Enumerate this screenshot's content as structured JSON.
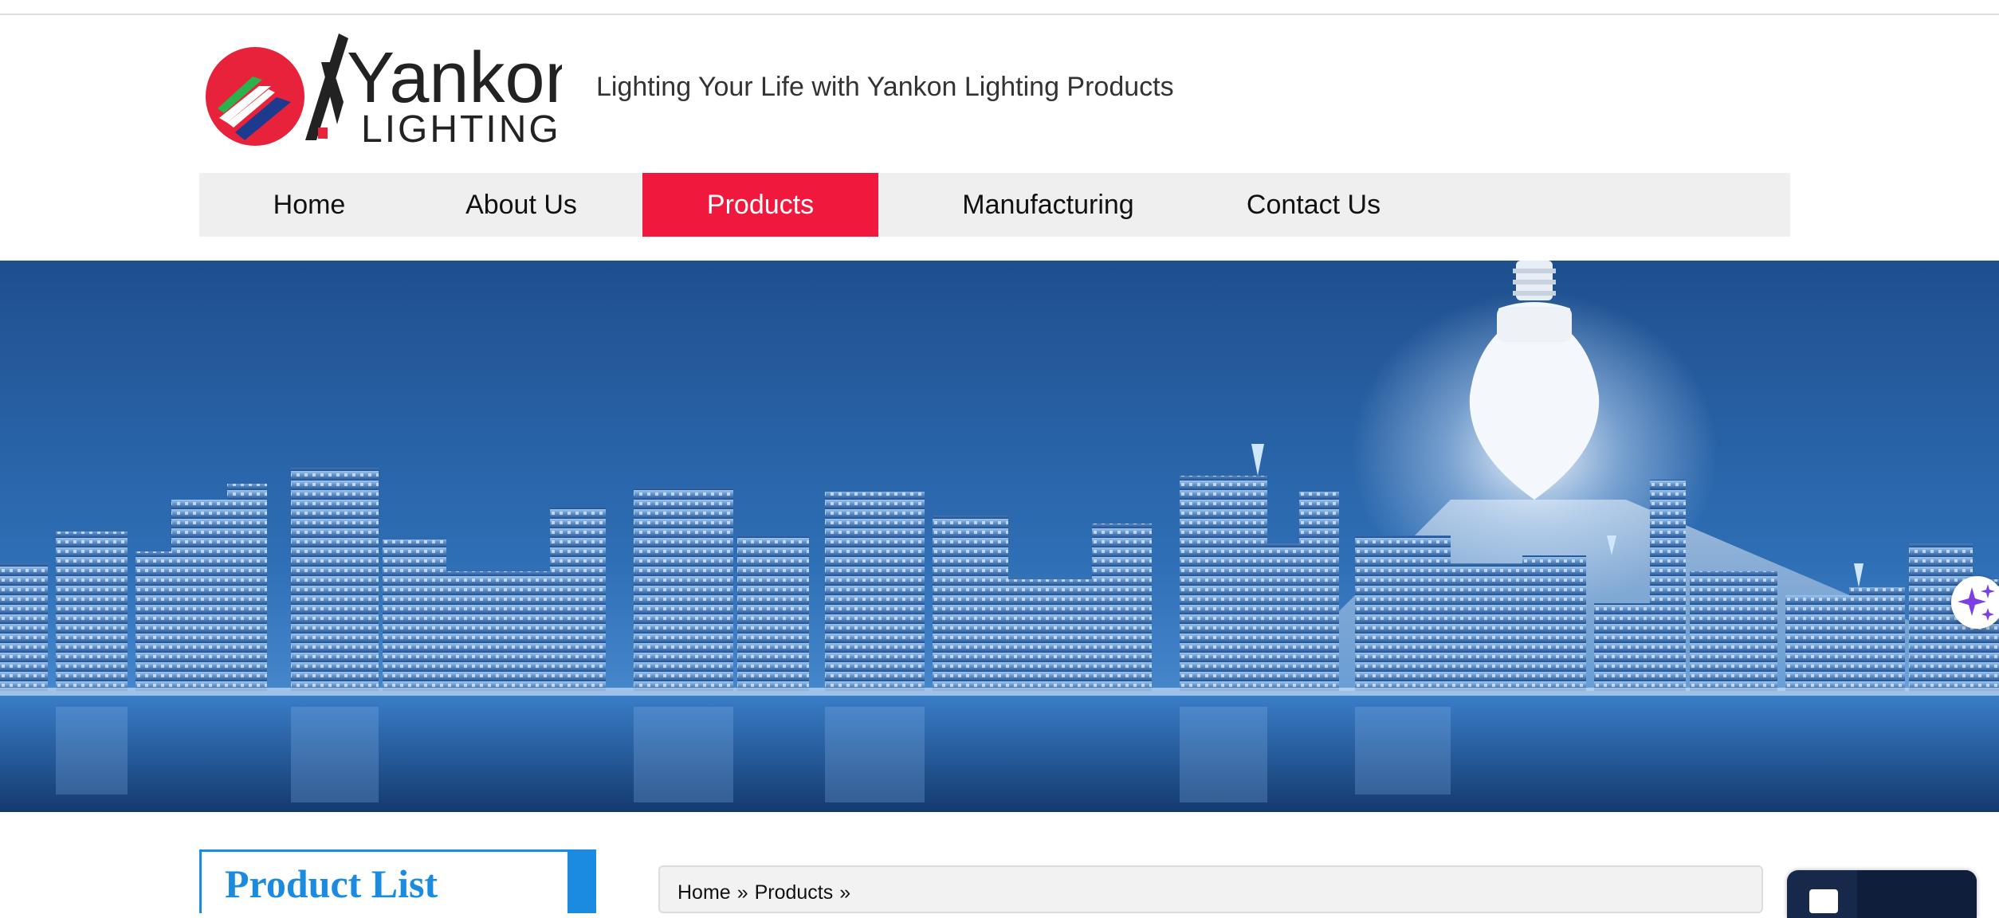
{
  "header": {
    "logo_text_top": "Yankon",
    "logo_text_bottom": "LIGHTING",
    "tagline": "Lighting Your Life with Yankon Lighting Products"
  },
  "nav": {
    "items": [
      {
        "label": "Home",
        "active": false
      },
      {
        "label": "About Us",
        "active": false
      },
      {
        "label": "Products",
        "active": true
      },
      {
        "label": "Manufacturing",
        "active": false
      },
      {
        "label": "Contact Us",
        "active": false
      }
    ],
    "active_color": "#f0193d"
  },
  "hero": {
    "image": "city-skyline-with-light-bulb-banner"
  },
  "sidebar": {
    "title": "Product List",
    "accent_color": "#1a8be0"
  },
  "breadcrumb": {
    "items": [
      "Home",
      "»",
      "Products",
      "»"
    ]
  },
  "floating": {
    "ai_button_icon": "sparkles-icon",
    "chat_icon": "chat-icon"
  }
}
